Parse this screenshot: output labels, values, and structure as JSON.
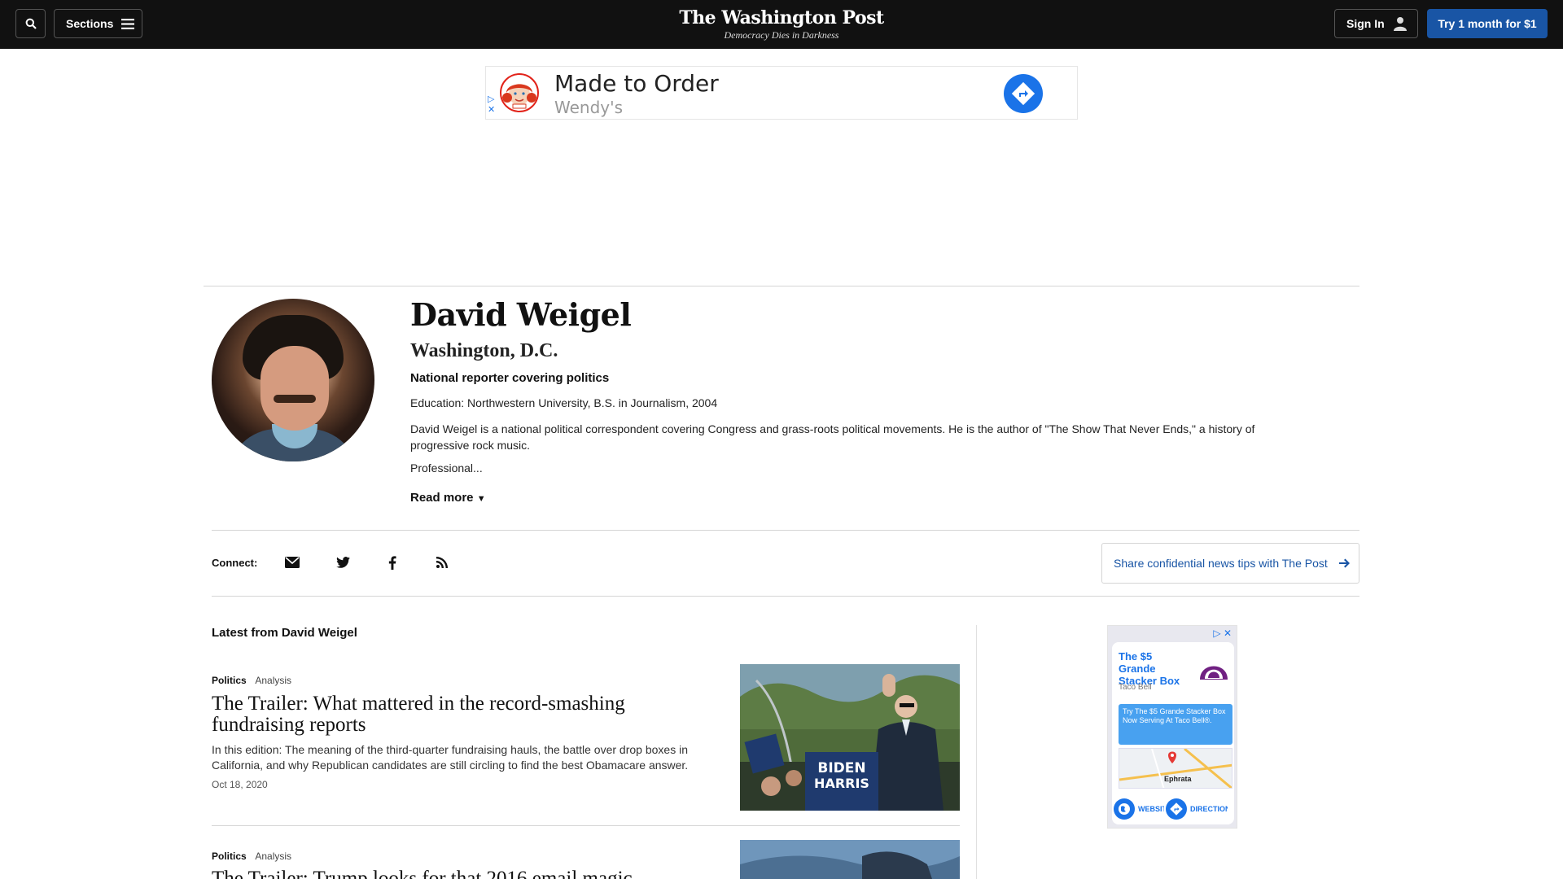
{
  "header": {
    "sections_label": "Sections",
    "logo_title": "The Washington Post",
    "logo_tagline": "Democracy Dies in Darkness",
    "signin_label": "Sign In",
    "subscribe_label": "Try 1 month for $1"
  },
  "top_ad": {
    "headline": "Made to Order",
    "brand": "Wendy's"
  },
  "profile": {
    "name": "David Weigel",
    "location": "Washington, D.C.",
    "role": "National reporter covering politics",
    "education": "Education: Northwestern University, B.S. in Journalism, 2004",
    "bio": "David Weigel is a national political correspondent covering Congress and grass-roots political movements. He is the author of \"The Show That Never Ends,\" a history of progressive rock music.",
    "professional": "Professional...",
    "read_more": "Read more"
  },
  "connect": {
    "label": "Connect:",
    "icons": [
      "email-icon",
      "twitter-icon",
      "facebook-icon",
      "rss-icon"
    ],
    "tips_label": "Share confidential news tips with The Post"
  },
  "latest": {
    "title": "Latest from David Weigel",
    "articles": [
      {
        "section": "Politics",
        "label": "Analysis",
        "headline": "The Trailer: What mattered in the record-smashing fundraising reports",
        "blurb": "In this edition: The meaning of the third-quarter fundraising hauls, the battle over drop boxes in California, and why Republican candidates are still circling to find the best Obamacare answer.",
        "date": "Oct 18, 2020"
      },
      {
        "section": "Politics",
        "label": "Analysis",
        "headline": "The Trailer: Trump looks for that 2016 email magic"
      }
    ]
  },
  "side_ad": {
    "headline": "The $5 Grande Stacker Box",
    "brand": "Taco Bell",
    "body": "Try The $5 Grande Stacker Box Now Serving At Taco Bell®.",
    "map_place": "Ephrata",
    "website_label": "WEBSITE",
    "directions_label": "DIRECTIONS"
  },
  "colors": {
    "topbar": "#111111",
    "subscribe_button": "#1955a5",
    "link": "#1955a5"
  }
}
